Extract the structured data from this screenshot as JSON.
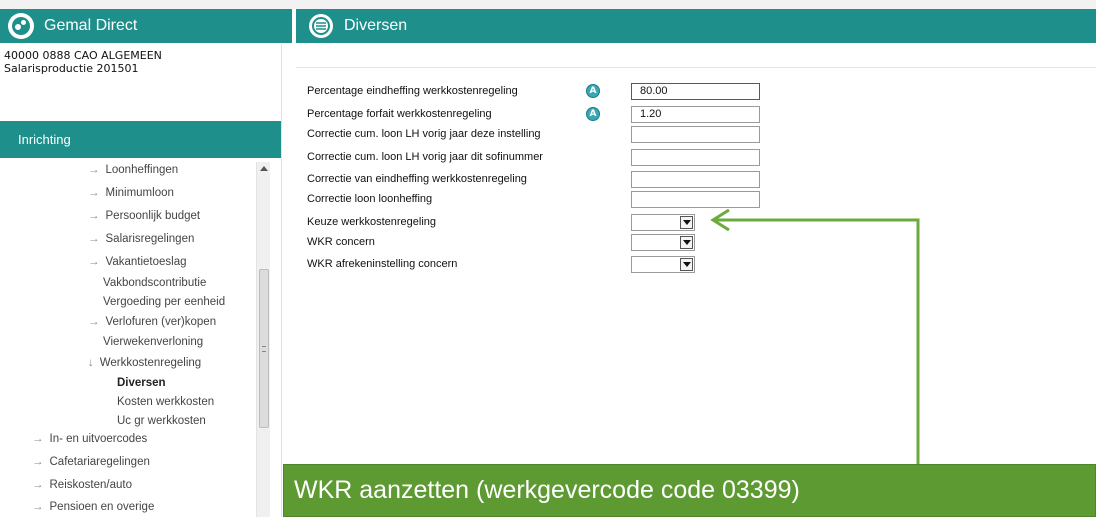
{
  "app": {
    "title": "Gemal Direct"
  },
  "page": {
    "title": "Diversen"
  },
  "client": {
    "line1": "40000 0888 CAO ALGEMEEN",
    "line2": "Salarisproductie  201501"
  },
  "nav": {
    "section": "Inrichting",
    "items": [
      {
        "label": "Loonheffingen",
        "arrow": "→"
      },
      {
        "label": "Minimumloon",
        "arrow": "→"
      },
      {
        "label": "Persoonlijk budget",
        "arrow": "→"
      },
      {
        "label": "Salarisregelingen",
        "arrow": "→"
      },
      {
        "label": "Vakantietoeslag",
        "arrow": "→"
      },
      {
        "label": "Vakbondscontributie",
        "arrow": ""
      },
      {
        "label": "Vergoeding per eenheid",
        "arrow": ""
      },
      {
        "label": "Verlofuren (ver)kopen",
        "arrow": "→"
      },
      {
        "label": "Vierwekenverloning",
        "arrow": ""
      },
      {
        "label": "Werkkostenregeling",
        "arrow": "↓"
      },
      {
        "label": "Diversen",
        "arrow": ""
      },
      {
        "label": "Kosten werkkosten",
        "arrow": ""
      },
      {
        "label": "Uc gr werkkosten",
        "arrow": ""
      },
      {
        "label": "In- en uitvoercodes",
        "arrow": "→"
      },
      {
        "label": "Cafetariaregelingen",
        "arrow": "→"
      },
      {
        "label": "Reiskosten/auto",
        "arrow": "→"
      },
      {
        "label": "Pensioen en overige",
        "arrow": "→"
      }
    ]
  },
  "form": {
    "info_glyph": "A",
    "fields": [
      {
        "label": "Percentage eindheffing werkkostenregeling",
        "value": "80.00"
      },
      {
        "label": "Percentage forfait werkkostenregeling",
        "value": "1.20"
      },
      {
        "label": "Correctie cum. loon LH vorig jaar deze instelling",
        "value": ""
      },
      {
        "label": "Correctie cum. loon LH vorig jaar dit sofinummer",
        "value": ""
      },
      {
        "label": "Correctie van eindheffing werkkostenregeling",
        "value": ""
      },
      {
        "label": "Correctie loon loonheffing",
        "value": ""
      }
    ],
    "selects": [
      {
        "label": "Keuze werkkostenregeling",
        "value": ""
      },
      {
        "label": "WKR concern",
        "value": ""
      },
      {
        "label": "WKR afrekeninstelling concern",
        "value": ""
      }
    ]
  },
  "annotation": {
    "text": "WKR aanzetten (werkgevercode code 03399)",
    "color": "#5d9a32"
  },
  "colors": {
    "brand": "#1e8f8a"
  }
}
